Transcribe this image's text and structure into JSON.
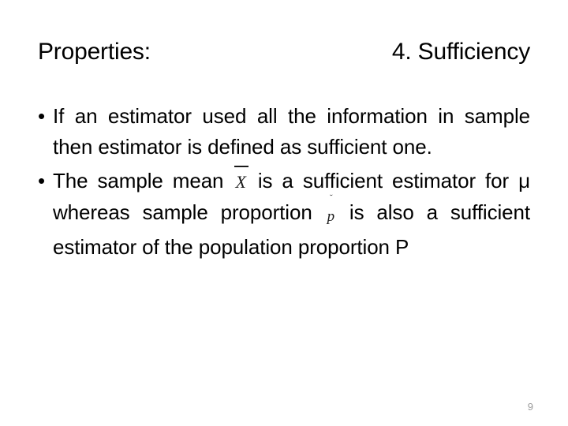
{
  "slide": {
    "background_color": "#ffffff",
    "text_color": "#000000",
    "title_left": "Properties:",
    "title_right": "4. Sufficiency",
    "page_number": "9",
    "page_number_color": "#9b9b9b",
    "bullets": [
      {
        "marker": "•",
        "segments": [
          {
            "kind": "text",
            "value": "If an estimator used all the information in sample then estimator is defined as sufficient one."
          }
        ]
      },
      {
        "marker": "•",
        "segments": [
          {
            "kind": "text",
            "value": "The sample mean "
          },
          {
            "kind": "math",
            "name": "x-bar",
            "base": "X",
            "accent": "bar",
            "value": "X̅"
          },
          {
            "kind": "text",
            "value": " is a sufficient estimator for μ whereas sample proportion "
          },
          {
            "kind": "math",
            "name": "p-hat",
            "base": "p",
            "accent": "hat",
            "value": "p̂"
          },
          {
            "kind": "text",
            "value": " is also a sufficient estimator of the population proportion P"
          }
        ]
      }
    ],
    "bullet1_text_a": "If an estimator used all the information in sample then estimator is defined as sufficient one.",
    "bullet2_text_a": "The sample mean",
    "bullet2_math_1_base": "X",
    "bullet2_text_b": "is a sufficient estimator for μ whereas sample proportion",
    "bullet2_math_2_base": "p",
    "bullet2_math_2_accent": "˘",
    "bullet2_text_c": "is also a sufficient estimator of the population proportion P"
  }
}
